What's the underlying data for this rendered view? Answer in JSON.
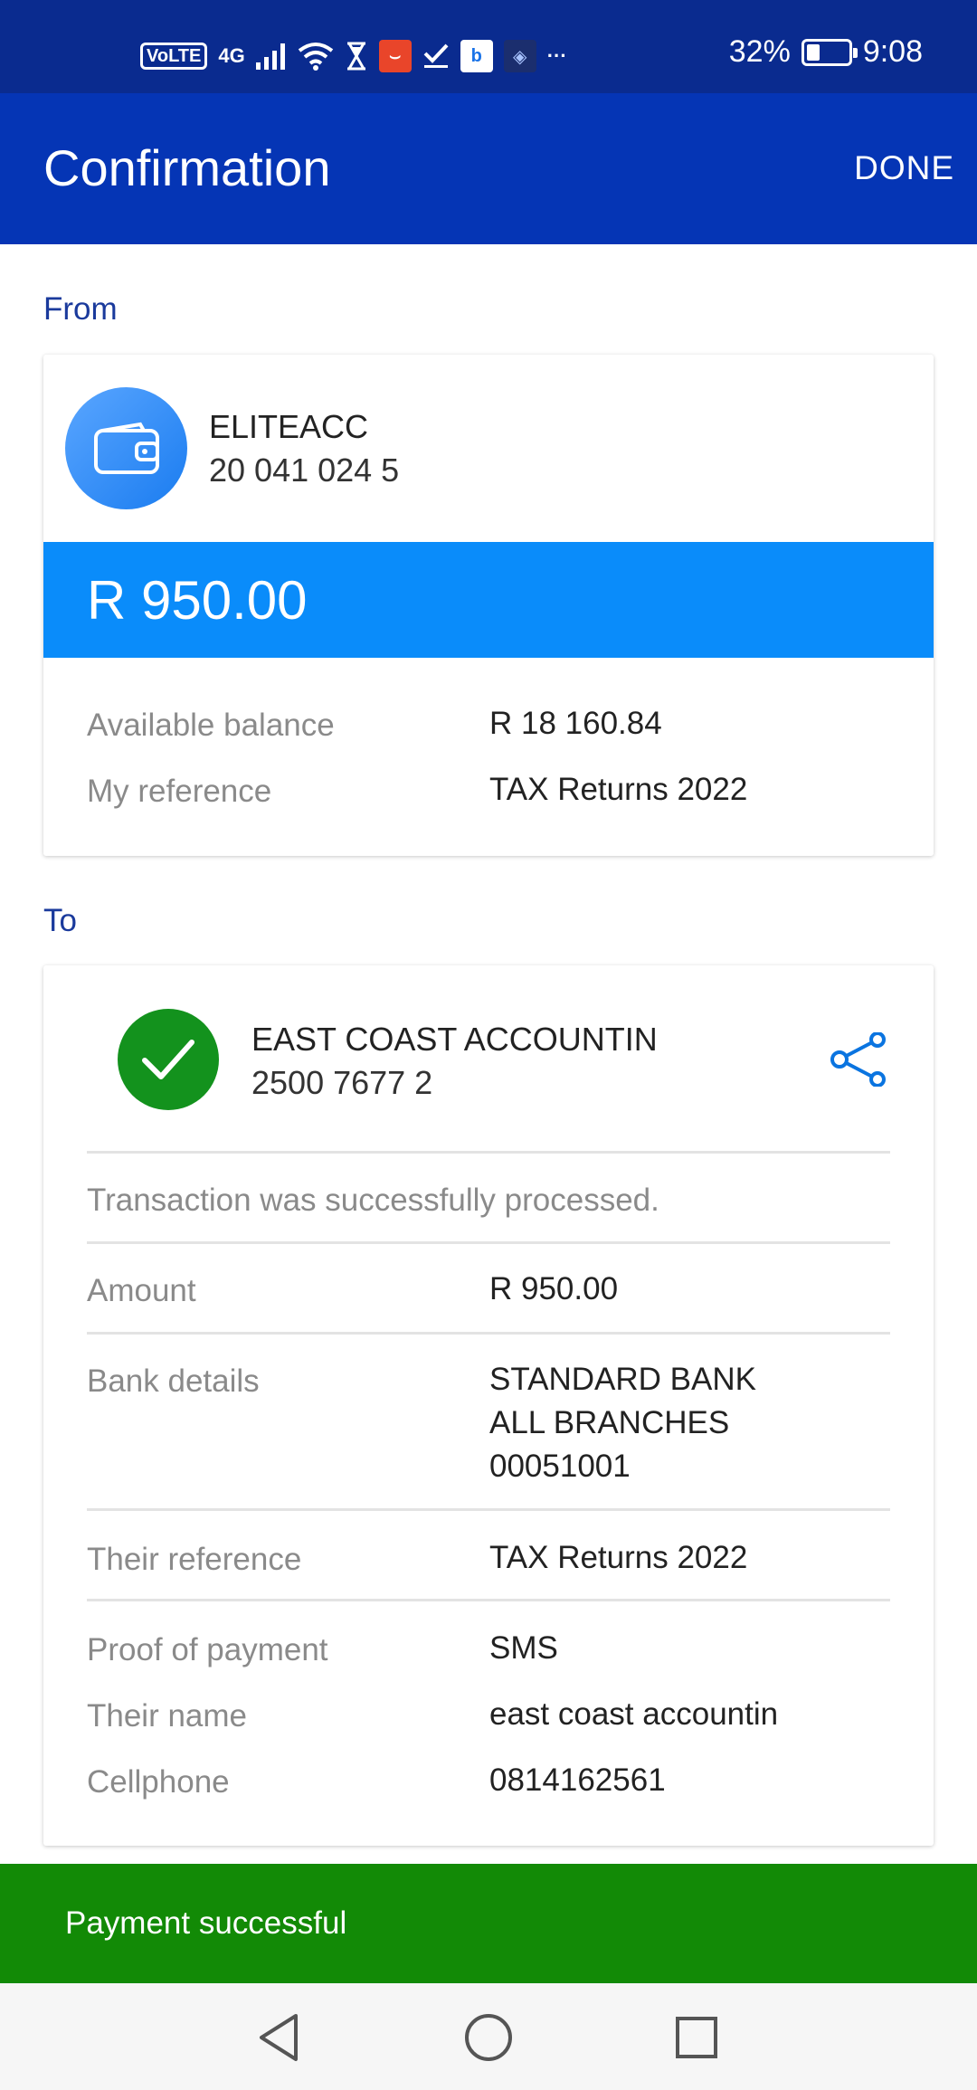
{
  "status_bar": {
    "volte": "VoLTE",
    "network": "4G",
    "battery_percent": "32%",
    "battery_level": 0.32,
    "time": "9:08",
    "more": "···"
  },
  "app_bar": {
    "title": "Confirmation",
    "done_label": "DONE"
  },
  "from": {
    "section_label": "From",
    "account_name": "ELITEACC",
    "account_number": "20 041 024 5",
    "amount": "R 950.00",
    "rows": [
      {
        "label": "Available balance",
        "value": "R 18 160.84"
      },
      {
        "label": "My reference",
        "value": "TAX Returns 2022"
      }
    ]
  },
  "to": {
    "section_label": "To",
    "recipient_name": "EAST COAST ACCOUNTIN",
    "recipient_account": "2500 7677 2",
    "status_message": "Transaction was successfully processed.",
    "amount": {
      "label": "Amount",
      "value": "R 950.00"
    },
    "bank": {
      "label": "Bank details",
      "line1": "STANDARD BANK",
      "line2": "ALL BRANCHES",
      "line3": "00051001"
    },
    "their_reference": {
      "label": "Their reference",
      "value": "TAX Returns 2022"
    },
    "proof": {
      "label": "Proof of payment",
      "value": "SMS"
    },
    "their_name": {
      "label": "Their name",
      "value": "east coast accountin"
    },
    "cellphone": {
      "label": "Cellphone",
      "value": "0814162561"
    }
  },
  "snackbar": {
    "message": "Payment successful"
  },
  "colors": {
    "status_bar": "#0a2b8f",
    "app_bar": "#0535b5",
    "amount_band": "#0a8cfa",
    "success_green": "#128a06",
    "check_green": "#13921d",
    "section_label": "#1a3a9c"
  },
  "icons": {
    "wallet": "wallet-icon",
    "check": "check-icon",
    "share": "share-icon",
    "back": "back-triangle-icon",
    "home": "home-circle-icon",
    "recents": "recents-square-icon"
  }
}
